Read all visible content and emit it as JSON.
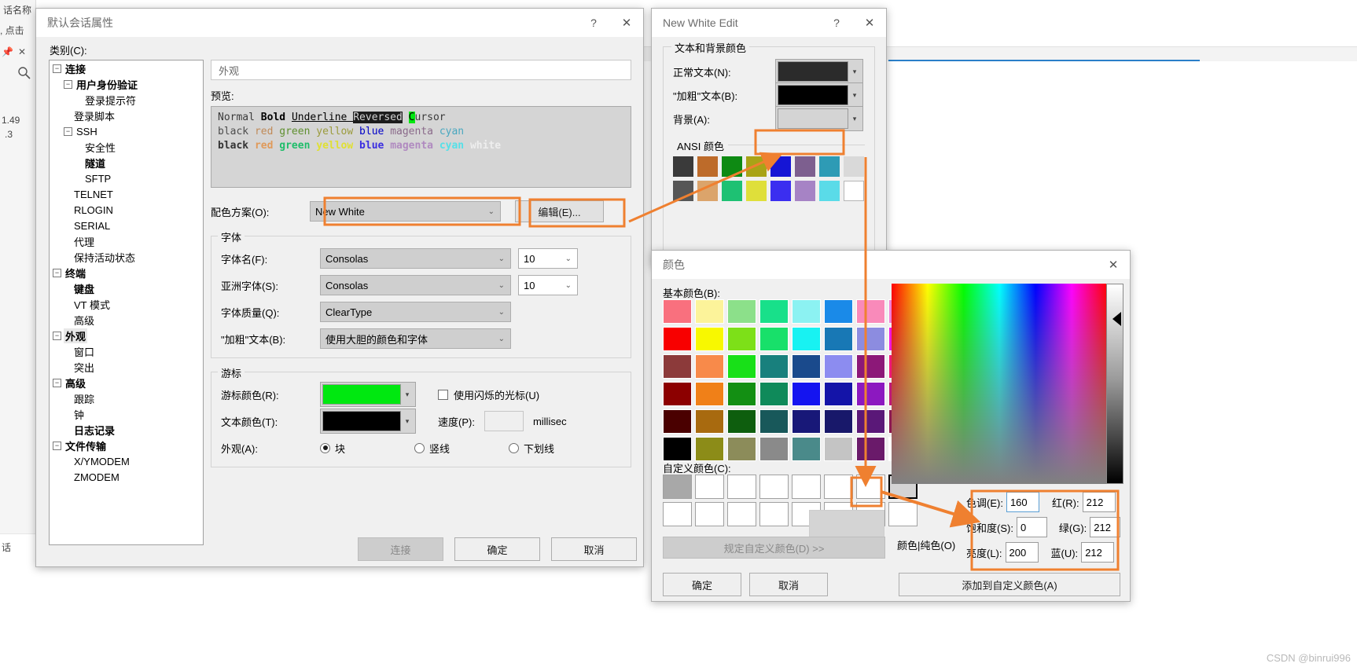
{
  "background_app": {
    "partial_texts": [
      "话名称",
      ", 点击",
      "1.49",
      ".3",
      "话"
    ],
    "icons": [
      "pin-icon",
      "close-icon",
      "search-icon"
    ]
  },
  "session_dialog": {
    "title": "默认会话属性",
    "help_label": "?",
    "close_label": "✕",
    "category_label": "类别(C):",
    "tree": [
      {
        "label": "连接",
        "depth": 0,
        "bold": true,
        "expander": "−"
      },
      {
        "label": "用户身份验证",
        "depth": 1,
        "bold": true,
        "expander": "−"
      },
      {
        "label": "登录提示符",
        "depth": 2,
        "bold": false,
        "expander": ""
      },
      {
        "label": "登录脚本",
        "depth": 1,
        "bold": false,
        "expander": ""
      },
      {
        "label": "SSH",
        "depth": 1,
        "bold": false,
        "expander": "−"
      },
      {
        "label": "安全性",
        "depth": 2,
        "bold": false,
        "expander": ""
      },
      {
        "label": "隧道",
        "depth": 2,
        "bold": true,
        "expander": ""
      },
      {
        "label": "SFTP",
        "depth": 2,
        "bold": false,
        "expander": ""
      },
      {
        "label": "TELNET",
        "depth": 1,
        "bold": false,
        "expander": ""
      },
      {
        "label": "RLOGIN",
        "depth": 1,
        "bold": false,
        "expander": ""
      },
      {
        "label": "SERIAL",
        "depth": 1,
        "bold": false,
        "expander": ""
      },
      {
        "label": "代理",
        "depth": 1,
        "bold": false,
        "expander": ""
      },
      {
        "label": "保持活动状态",
        "depth": 1,
        "bold": false,
        "expander": ""
      },
      {
        "label": "终端",
        "depth": 0,
        "bold": true,
        "expander": "−"
      },
      {
        "label": "键盘",
        "depth": 1,
        "bold": true,
        "expander": ""
      },
      {
        "label": "VT 模式",
        "depth": 1,
        "bold": false,
        "expander": ""
      },
      {
        "label": "高级",
        "depth": 1,
        "bold": false,
        "expander": ""
      },
      {
        "label": "外观",
        "depth": 0,
        "bold": true,
        "expander": "−",
        "selected": true
      },
      {
        "label": "窗口",
        "depth": 1,
        "bold": false,
        "expander": ""
      },
      {
        "label": "突出",
        "depth": 1,
        "bold": false,
        "expander": ""
      },
      {
        "label": "高级",
        "depth": 0,
        "bold": true,
        "expander": "−"
      },
      {
        "label": "跟踪",
        "depth": 1,
        "bold": false,
        "expander": ""
      },
      {
        "label": "钟",
        "depth": 1,
        "bold": false,
        "expander": ""
      },
      {
        "label": "日志记录",
        "depth": 1,
        "bold": true,
        "expander": ""
      },
      {
        "label": "文件传输",
        "depth": 0,
        "bold": true,
        "expander": "−"
      },
      {
        "label": "X/YMODEM",
        "depth": 1,
        "bold": false,
        "expander": ""
      },
      {
        "label": "ZMODEM",
        "depth": 1,
        "bold": false,
        "expander": ""
      }
    ],
    "page_header": "外观",
    "preview_label": "预览:",
    "preview": {
      "line1": [
        {
          "text": "Normal ",
          "style": "normal"
        },
        {
          "text": "Bold ",
          "style": "bold"
        },
        {
          "text": "Underline ",
          "style": "underline"
        },
        {
          "text": "Reversed",
          "style": "reversed"
        },
        {
          "text": " ",
          "style": "normal"
        },
        {
          "text": "C",
          "style": "cursor"
        },
        {
          "text": "ursor",
          "style": "normal"
        }
      ],
      "line2": [
        "black",
        "red",
        "green",
        "yellow",
        "blue",
        "magenta",
        "cyan"
      ],
      "line3": [
        "black",
        "red",
        "green",
        "yellow",
        "blue",
        "magenta",
        "cyan",
        "white"
      ],
      "line2_colors": [
        "#4d4d4d",
        "#c08a58",
        "#5f8f2f",
        "#9b9b3c",
        "#0000c8",
        "#8a6a8a",
        "#4aa8c0"
      ],
      "line3_colors": [
        "#333333",
        "#e09a5a",
        "#1fbd6a",
        "#e0e033",
        "#3b2ee0",
        "#b08ac0",
        "#55e0e8",
        "#eeeeee"
      ],
      "background": "#d5d5d5"
    },
    "scheme_label": "配色方案(O):",
    "scheme_value": "New White",
    "edit_button": "编辑(E)...",
    "font_group": "字体",
    "font_name_label": "字体名(F):",
    "font_name_value": "Consolas",
    "font_size_value": "10",
    "asia_font_label": "亚洲字体(S):",
    "asia_font_value": "Consolas",
    "asia_font_size_value": "10",
    "font_quality_label": "字体质量(Q):",
    "font_quality_value": "ClearType",
    "bold_text_label": "\"加粗\"文本(B):",
    "bold_text_value": "使用大胆的颜色和字体",
    "cursor_group": "游标",
    "cursor_color_label": "游标颜色(R):",
    "cursor_color_value": "#00e810",
    "text_color_label": "文本颜色(T):",
    "text_color_value": "#000000",
    "blink_checkbox_label": "使用闪烁的光标(U)",
    "blink_checked": false,
    "speed_label": "速度(P):",
    "speed_value": "",
    "speed_unit": "millisec",
    "appearance_label": "外观(A):",
    "appearance_options": [
      {
        "label": "块",
        "selected": true
      },
      {
        "label": "竖线",
        "selected": false
      },
      {
        "label": "下划线",
        "selected": false
      }
    ],
    "buttons": {
      "connect": "连接",
      "connect_disabled": true,
      "ok": "确定",
      "cancel": "取消"
    }
  },
  "edit_dialog": {
    "title": "New White Edit",
    "help_label": "?",
    "close_label": "✕",
    "group_title": "文本和背景颜色",
    "rows": [
      {
        "label": "正常文本(N):",
        "color": "#2b2b2b"
      },
      {
        "label": "\"加粗\"文本(B):",
        "color": "#000000"
      },
      {
        "label": "背景(A):",
        "color": "#d4d4d4",
        "highlighted": true
      }
    ],
    "ansi_group": "ANSI 颜色",
    "ansi_row1": [
      "#3a3a3a",
      "#bd6b2a",
      "#0e8a13",
      "#a8a317",
      "#1515d5",
      "#7d5f8f",
      "#2e9bb5",
      "#d9d9d9"
    ],
    "ansi_row2": [
      "#565656",
      "#dba46b",
      "#1ec173",
      "#dfdf3a",
      "#3b2ef0",
      "#a683c5",
      "#5adbe8",
      "#ffffff"
    ]
  },
  "color_dialog": {
    "title": "颜色",
    "close_label": "✕",
    "basic_label": "基本颜色(B):",
    "basic_colors": [
      [
        "#f9707e",
        "#fcf39a",
        "#8ce08a",
        "#18e08a",
        "#8cf2f2",
        "#1a8ae8",
        "#f98aba",
        "#f080d8"
      ],
      [
        "#f80000",
        "#f8f800",
        "#7de018",
        "#18e06a",
        "#18f2f2",
        "#1878b5",
        "#8c8ce0",
        "#f018e0"
      ],
      [
        "#8c3a3a",
        "#f88a4a",
        "#18e018",
        "#18807d",
        "#1a4a8c",
        "#8c8cf0",
        "#8c1878",
        "#f01878"
      ],
      [
        "#8c0000",
        "#f08018",
        "#138f13",
        "#0f8a5a",
        "#1414f0",
        "#1414a8",
        "#8c18c0",
        "#c01878"
      ],
      [
        "#4a0000",
        "#a86a0f",
        "#0e5e0e",
        "#18585a",
        "#181878",
        "#18186a",
        "#5a1878",
        "#8c1850"
      ],
      [
        "#000000",
        "#8c8c18",
        "#8c8c5a",
        "#8a8a8a",
        "#4a8a8a",
        "#c4c4c4",
        "#6a1a6a",
        "#ffffff"
      ]
    ],
    "custom_label": "自定义颜色(C):",
    "custom_row1": [
      "#a8a8a8",
      "#ffffff",
      "#ffffff",
      "#ffffff",
      "#ffffff",
      "#ffffff",
      "#ffffff",
      "#d4d4d4"
    ],
    "custom_row2": [
      "#ffffff",
      "#ffffff",
      "#ffffff",
      "#ffffff",
      "#ffffff",
      "#ffffff",
      "#ffffff",
      "#ffffff"
    ],
    "custom_selected_index": 7,
    "define_button": "规定自定义颜色(D) >>",
    "solid_label": "颜色|纯色(O)",
    "ok_button": "确定",
    "cancel_button": "取消",
    "add_custom_button": "添加到自定义颜色(A)",
    "fields": [
      {
        "label": "色调(E):",
        "value": "160",
        "focused": true
      },
      {
        "label": "红(R):",
        "value": "212"
      },
      {
        "label": "饱和度(S):",
        "value": "0"
      },
      {
        "label": "绿(G):",
        "value": "212"
      },
      {
        "label": "亮度(L):",
        "value": "200"
      },
      {
        "label": "蓝(U):",
        "value": "212"
      }
    ],
    "preview_color": "#d4d4d4"
  },
  "annotation": {
    "accent_color": "#ef8030",
    "watermark": "CSDN @binrui996"
  }
}
